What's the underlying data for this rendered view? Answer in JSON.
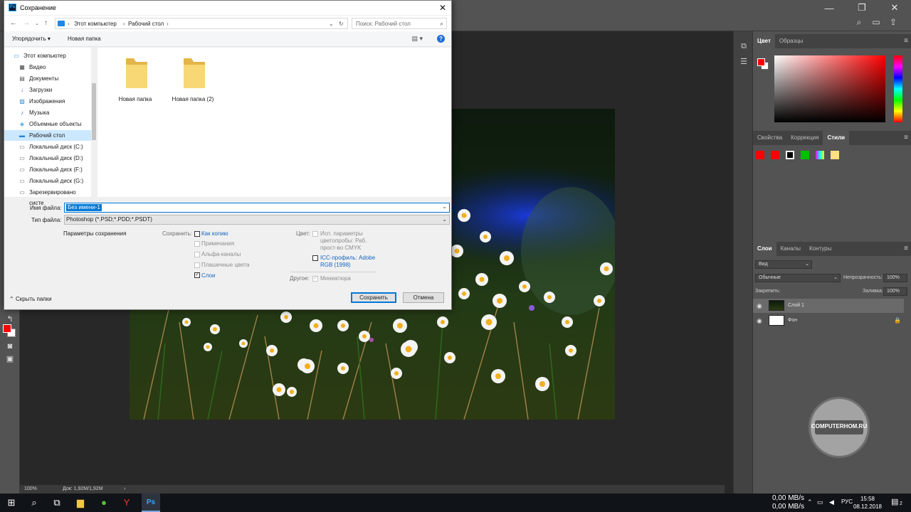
{
  "save_dialog": {
    "title": "Сохранение",
    "breadcrumb": [
      "Этот компьютер",
      "Рабочий стол"
    ],
    "search_placeholder": "Поиск: Рабочий стол",
    "organize_label": "Упорядочить ▾",
    "new_folder_label": "Новая папка",
    "nav_items": [
      {
        "label": "Этот компьютер",
        "icon": "computer-icon"
      },
      {
        "label": "Видео",
        "icon": "video-icon"
      },
      {
        "label": "Документы",
        "icon": "documents-icon"
      },
      {
        "label": "Загрузки",
        "icon": "downloads-icon"
      },
      {
        "label": "Изображения",
        "icon": "pictures-icon"
      },
      {
        "label": "Музыка",
        "icon": "music-icon"
      },
      {
        "label": "Объемные объекты",
        "icon": "3d-objects-icon"
      },
      {
        "label": "Рабочий стол",
        "icon": "desktop-icon",
        "selected": true
      },
      {
        "label": "Локальный диск (C:)",
        "icon": "drive-icon"
      },
      {
        "label": "Локальный диск (D:)",
        "icon": "drive-icon"
      },
      {
        "label": "Локальный диск (F:)",
        "icon": "drive-icon"
      },
      {
        "label": "Локальный диск (G:)",
        "icon": "drive-icon"
      },
      {
        "label": "Зарезервировано систе",
        "icon": "drive-icon"
      }
    ],
    "folders": [
      "Новая папка",
      "Новая папка (2)"
    ],
    "filename_label": "Имя файла:",
    "filename_value": "Без имени-1",
    "filetype_label": "Тип файла:",
    "filetype_value": "Photoshop (*.PSD;*.PDD;*.PSDT)",
    "save_params_label": "Параметры сохранения",
    "save_label": "Сохранить:",
    "options": {
      "as_copy": "Как копию",
      "notes": "Примечания",
      "alpha": "Альфа-каналы",
      "spot": "Плашечные цвета",
      "layers": "Слои"
    },
    "color_label": "Цвет:",
    "proof_setup": "Исп. параметры цветопробы: Раб. прост-во CMYK",
    "icc_profile": "ICC-профиль: Adobe RGB (1998)",
    "other_label": "Другое:",
    "thumbnail": "Миниатюра",
    "save_button": "Сохранить",
    "cancel_button": "Отмена",
    "hide_folders": "Скрыть папки"
  },
  "panels": {
    "color_tabs": [
      "Цвет",
      "Образцы"
    ],
    "props_tabs": [
      "Свойства",
      "Коррекция",
      "Стили"
    ],
    "style_swatch_colors": [
      "#ff0000",
      "#ff0000",
      "#000000",
      "#00c000",
      "#6060ff",
      "#ffe080"
    ],
    "layers_tabs": [
      "Слои",
      "Каналы",
      "Контуры"
    ],
    "kind_filter": "Вид",
    "blend_mode": "Обычные",
    "opacity_label": "Непрозрачность:",
    "opacity_value": "100%",
    "lock_label": "Закрепить:",
    "fill_label": "Заливка:",
    "fill_value": "100%",
    "layers": [
      {
        "name": "Слой 1",
        "locked": false
      },
      {
        "name": "Фон",
        "locked": true
      }
    ]
  },
  "status": {
    "zoom": "100%",
    "doc_size": "Док: 1,92M/1,92M"
  },
  "watermark_text": "COMPUTERHOM.RU",
  "taskbar": {
    "net_up": "0,00 MB/s",
    "net_down": "0,00 MB/s",
    "lang": "РУС",
    "time": "15:58",
    "date": "08.12.2018",
    "notifications": "2"
  }
}
